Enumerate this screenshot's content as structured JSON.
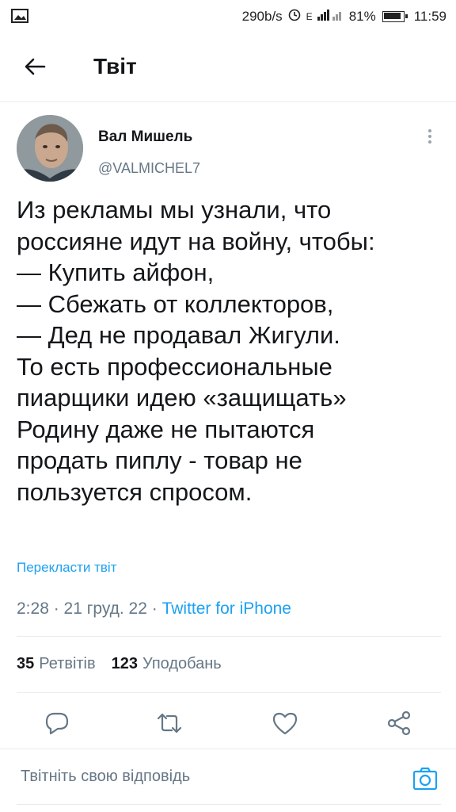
{
  "status_bar": {
    "speed": "290b/s",
    "network": "E",
    "battery": "81%",
    "time": "11:59"
  },
  "header": {
    "title": "Твіт",
    "back_icon": "arrow-left-icon"
  },
  "tweet": {
    "author_name": "Вал Мишель",
    "author_handle": "@VALMICHEL7",
    "text": "Из рекламы мы узнали, что\nроссияне идут на войну, чтобы:\n— Купить айфон,\n— Сбежать от коллекторов,\n— Дед не продавал Жигули.\nТо есть профессиональные\nпиарщики идею «защищать»\nРодину даже не пытаются\nпродать пиплу - товар не\nпользуется спросом.",
    "translate_label": "Перекласти твіт",
    "meta_time": "2:28 · 21 груд. 22 · ",
    "meta_source": "Twitter for iPhone",
    "retweets_count": "35",
    "retweets_label": "Ретвітів",
    "likes_count": "123",
    "likes_label": "Уподобань"
  },
  "actions": {
    "reply_icon": "reply-icon",
    "retweet_icon": "retweet-icon",
    "like_icon": "heart-icon",
    "share_icon": "share-icon"
  },
  "reply": {
    "placeholder": "Твітніть свою відповідь",
    "camera_icon": "camera-icon"
  },
  "colors": {
    "accent": "#1da1f2",
    "secondary_text": "#657786",
    "icon": "#657786"
  }
}
